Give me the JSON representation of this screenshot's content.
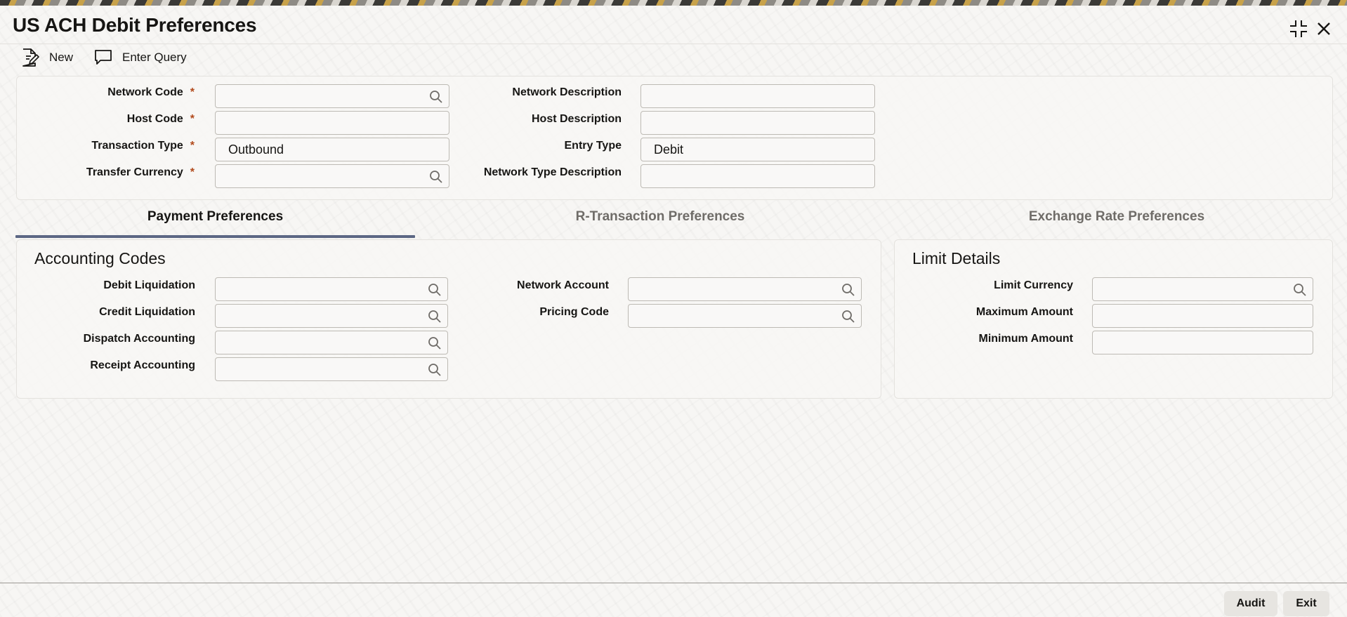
{
  "window": {
    "title": "US ACH Debit Preferences"
  },
  "toolbar": {
    "new_label": "New",
    "enter_query_label": "Enter Query"
  },
  "header_fields": {
    "network_code": {
      "label": "Network Code",
      "required": "*",
      "value": ""
    },
    "host_code": {
      "label": "Host Code",
      "required": "*",
      "value": ""
    },
    "transaction_type": {
      "label": "Transaction Type",
      "required": "*",
      "value": "Outbound"
    },
    "transfer_currency": {
      "label": "Transfer Currency",
      "required": "*",
      "value": ""
    },
    "network_description": {
      "label": "Network Description",
      "value": ""
    },
    "host_description": {
      "label": "Host Description",
      "value": ""
    },
    "entry_type": {
      "label": "Entry Type",
      "value": "Debit"
    },
    "network_type_description": {
      "label": "Network Type Description",
      "value": ""
    }
  },
  "tabs": [
    {
      "label": "Payment Preferences",
      "active": true
    },
    {
      "label": "R-Transaction Preferences",
      "active": false
    },
    {
      "label": "Exchange Rate Preferences",
      "active": false
    }
  ],
  "accounting_codes": {
    "title": "Accounting Codes",
    "debit_liquidation": {
      "label": "Debit Liquidation",
      "value": ""
    },
    "credit_liquidation": {
      "label": "Credit Liquidation",
      "value": ""
    },
    "dispatch_accounting": {
      "label": "Dispatch Accounting",
      "value": ""
    },
    "receipt_accounting": {
      "label": "Receipt Accounting",
      "value": ""
    },
    "network_account": {
      "label": "Network Account",
      "value": ""
    },
    "pricing_code": {
      "label": "Pricing Code",
      "value": ""
    }
  },
  "limit_details": {
    "title": "Limit Details",
    "limit_currency": {
      "label": "Limit Currency",
      "value": ""
    },
    "maximum_amount": {
      "label": "Maximum Amount",
      "value": ""
    },
    "minimum_amount": {
      "label": "Minimum Amount",
      "value": ""
    }
  },
  "footer": {
    "audit_label": "Audit",
    "exit_label": "Exit"
  },
  "icons": {
    "new": "new-document-icon",
    "enter_query": "speech-bubble-icon",
    "lov": "search-icon",
    "minimize": "collapse-icon",
    "close": "close-icon"
  },
  "colors": {
    "required_marker": "#b24a1c",
    "active_tab_underline": "#5c6784"
  }
}
